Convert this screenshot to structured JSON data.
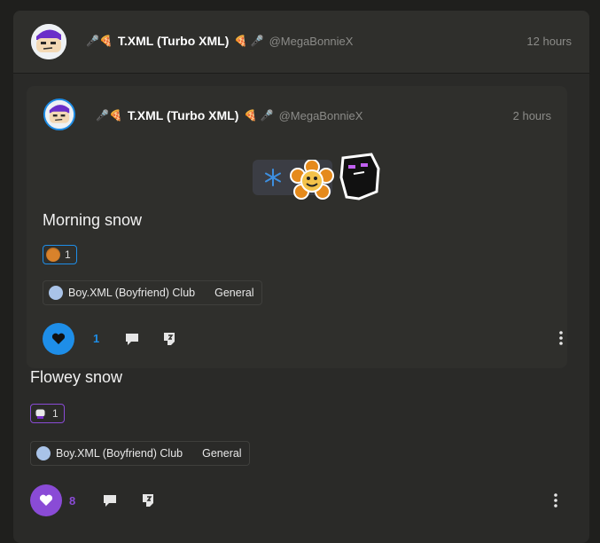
{
  "outer_post": {
    "author": {
      "display_name": "T.XML (Turbo XML)",
      "handle": "@MegaBonnieX",
      "prefix_emoji": "🎤🍕",
      "suffix_emoji": "🍕 🎤"
    },
    "time": "12 hours",
    "title": "Flowey snow",
    "reaction": {
      "icon": "glove-sticker-icon",
      "count": "1",
      "border_color": "#8a4bd6"
    },
    "club": {
      "name": "Boy.XML (Boyfriend) Club",
      "channel": "General"
    },
    "likes": {
      "count": "8",
      "color": "#8a4bd6"
    }
  },
  "inner_post": {
    "author": {
      "display_name": "T.XML (Turbo XML)",
      "handle": "@MegaBonnieX",
      "prefix_emoji": "🎤🍕",
      "suffix_emoji": "🍕 🎤"
    },
    "time": "2 hours",
    "title": "Morning snow",
    "stickers": [
      "snowflake-icon",
      "flowey-sticker-icon",
      "enderman-sticker-icon"
    ],
    "reaction": {
      "icon": "pumpkin-sticker-icon",
      "count": "1",
      "border_color": "#1e8ee8"
    },
    "club": {
      "name": "Boy.XML (Boyfriend) Club",
      "channel": "General"
    },
    "likes": {
      "count": "1",
      "color": "#1e8ee8"
    }
  }
}
